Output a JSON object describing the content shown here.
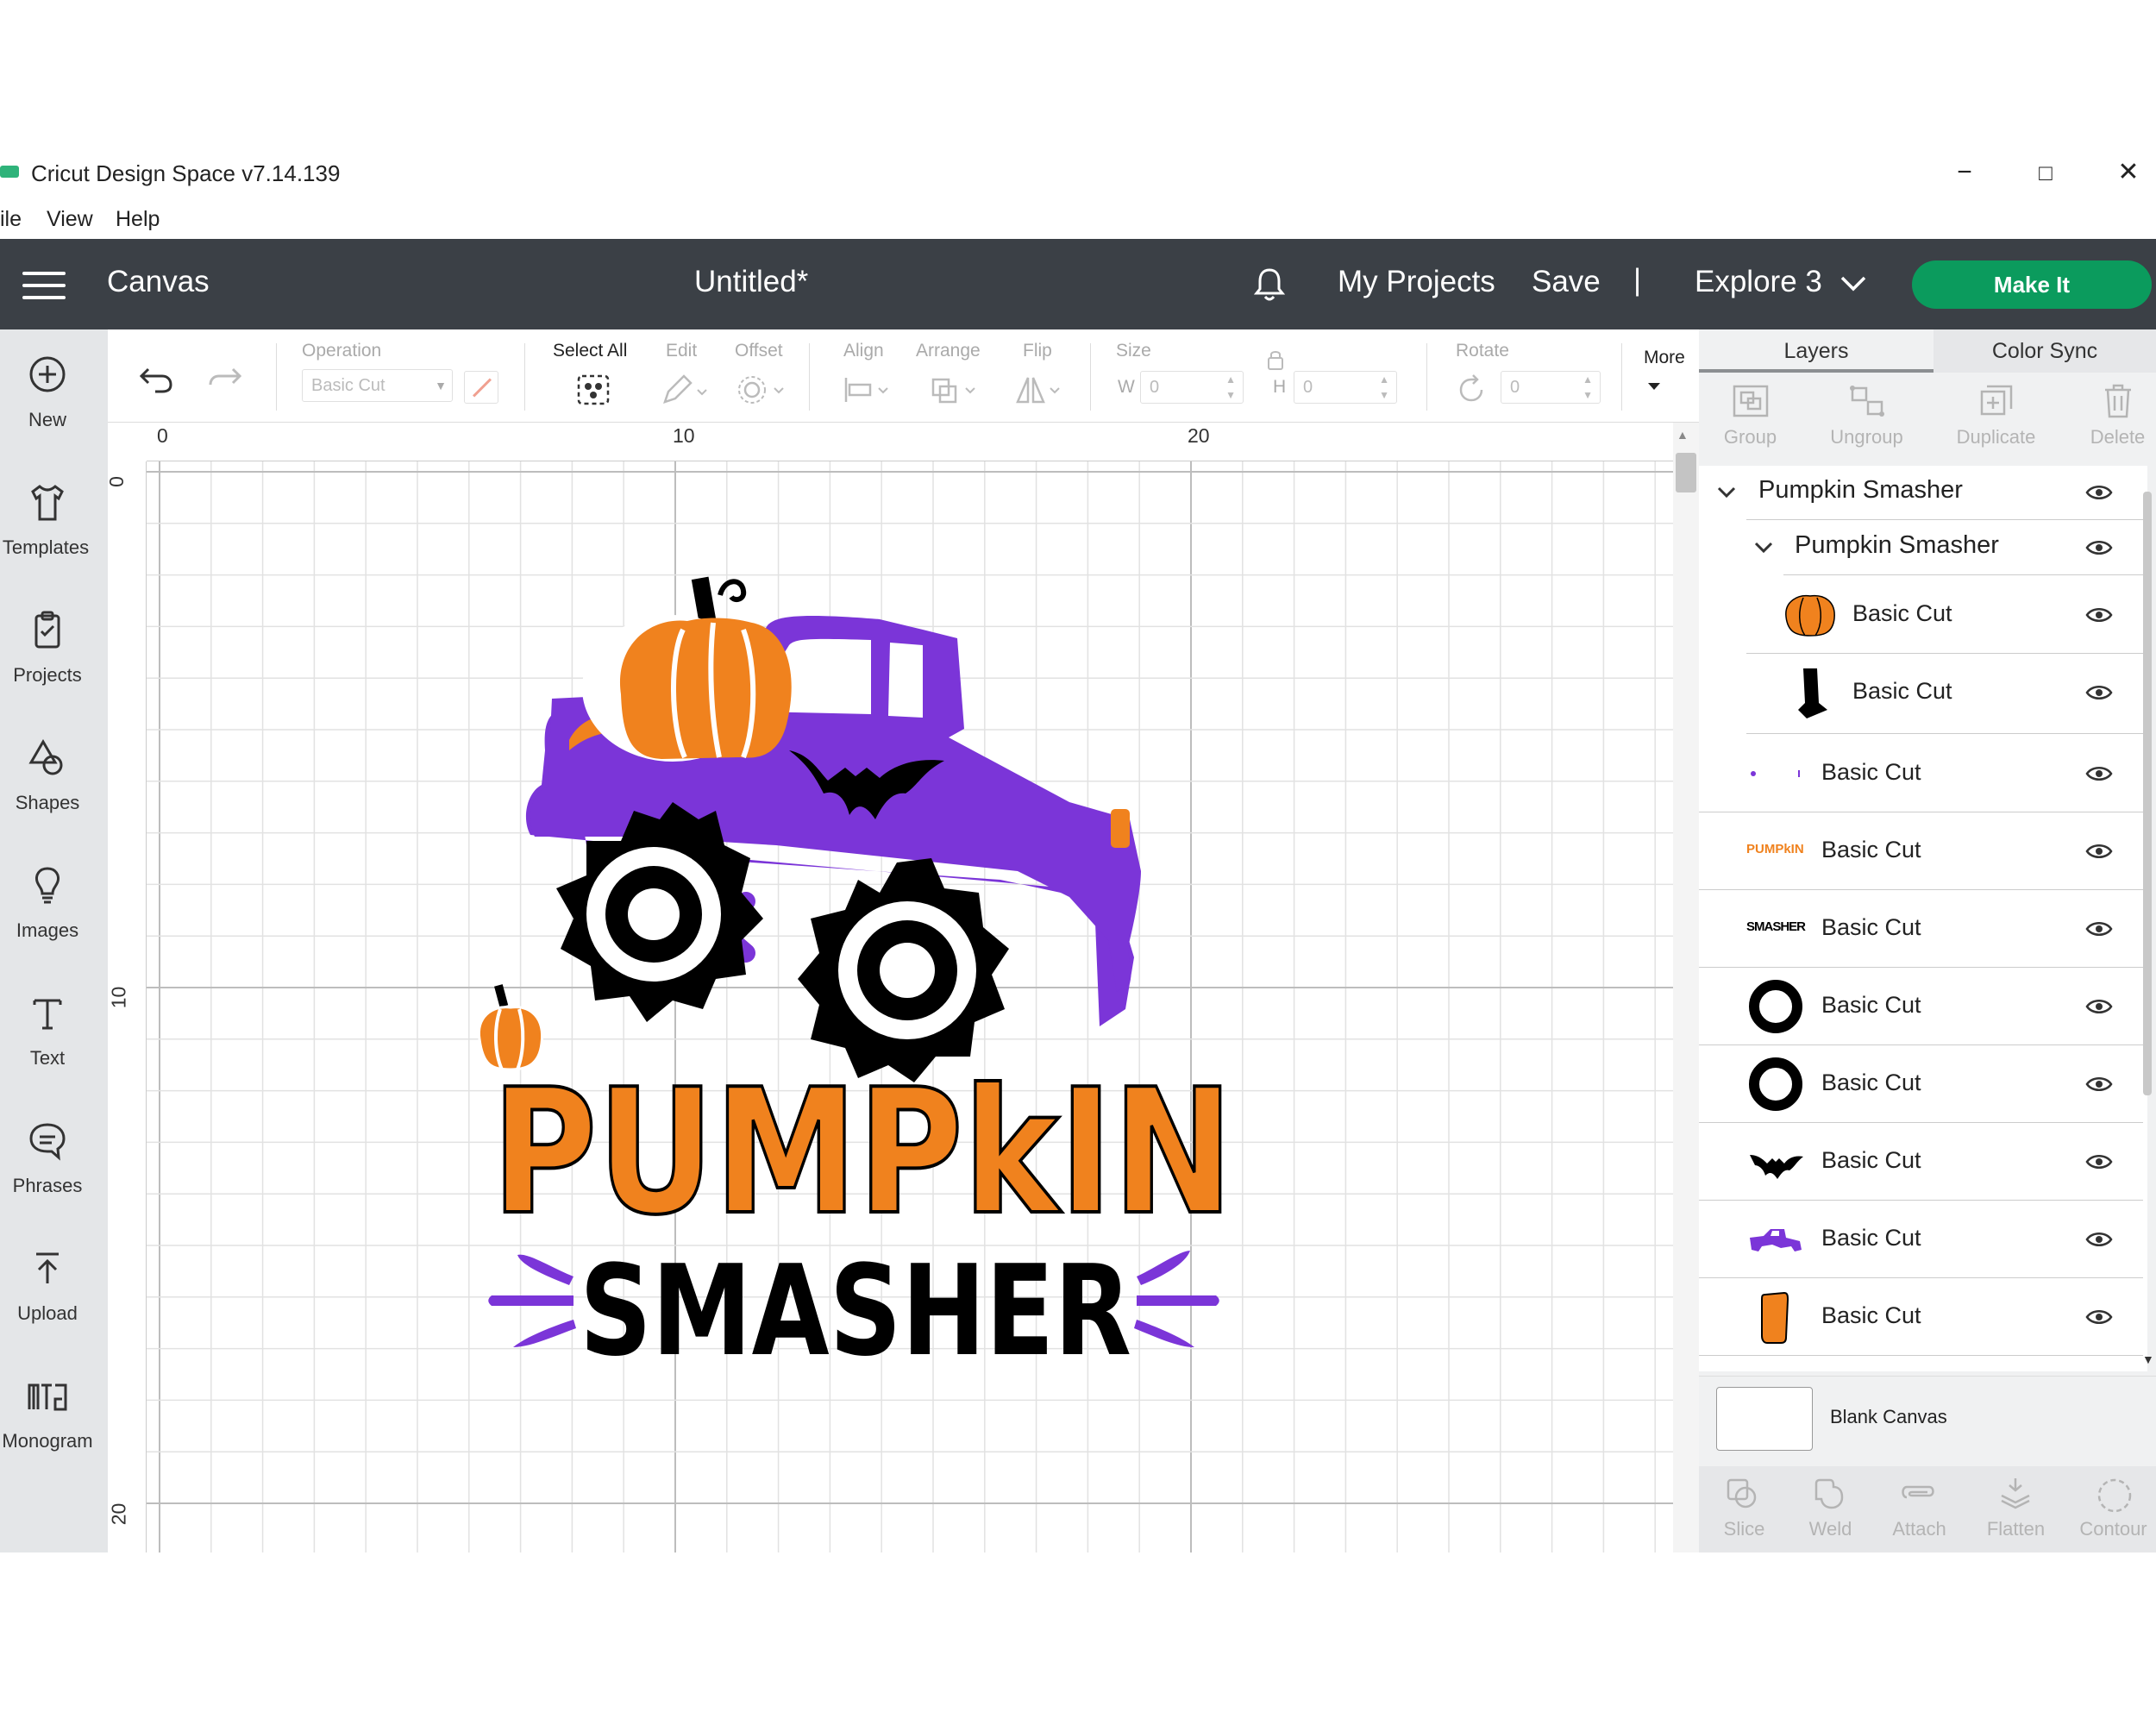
{
  "window": {
    "title": "Cricut Design Space  v7.14.139",
    "minimize": "−",
    "maximize": "□",
    "close": "✕"
  },
  "menu": [
    "ile",
    "View",
    "Help"
  ],
  "header": {
    "canvas_label": "Canvas",
    "doc_title": "Untitled*",
    "my_projects": "My Projects",
    "save": "Save",
    "divider": "|",
    "machine": "Explore 3",
    "make_it": "Make It"
  },
  "sidebar": [
    {
      "label": "New",
      "icon": "plus-circle-icon"
    },
    {
      "label": "Templates",
      "icon": "tshirt-icon"
    },
    {
      "label": "Projects",
      "icon": "clipboard-icon"
    },
    {
      "label": "Shapes",
      "icon": "shapes-icon"
    },
    {
      "label": "Images",
      "icon": "lightbulb-icon"
    },
    {
      "label": "Text",
      "icon": "text-t-icon"
    },
    {
      "label": "Phrases",
      "icon": "speech-bubble-icon"
    },
    {
      "label": "Upload",
      "icon": "upload-icon"
    },
    {
      "label": "Monogram",
      "icon": "monogram-icon"
    }
  ],
  "toolbar": {
    "operation_label": "Operation",
    "operation_value": "Basic Cut",
    "select_all": "Select All",
    "edit": "Edit",
    "offset": "Offset",
    "align": "Align",
    "arrange": "Arrange",
    "flip": "Flip",
    "size": "Size",
    "w": "W",
    "h": "H",
    "w_value": "0",
    "h_value": "0",
    "rotate": "Rotate",
    "rotate_value": "0",
    "more": "More"
  },
  "rulers": {
    "top": [
      "0",
      "10",
      "20"
    ],
    "left": [
      "0",
      "10",
      "20"
    ]
  },
  "design_text": {
    "line1": "PUMPkIN",
    "line2": "SMASHER"
  },
  "colors": {
    "purple": "#7b35d8",
    "orange": "#f0821e",
    "black": "#000000",
    "header_bg": "#3b4046",
    "make_it_green": "#0b9b5d"
  },
  "panel": {
    "tabs": [
      "Layers",
      "Color Sync"
    ],
    "actions": [
      "Group",
      "Ungroup",
      "Duplicate",
      "Delete"
    ],
    "group_top": "Pumpkin Smasher",
    "group_sub": "Pumpkin Smasher",
    "layers": [
      {
        "label": "Basic Cut",
        "thumb": "pumpkin-body"
      },
      {
        "label": "Basic Cut",
        "thumb": "pumpkin-stem"
      },
      {
        "label": "Basic Cut",
        "thumb": "dots"
      },
      {
        "label": "Basic Cut",
        "thumb": "text-pumpkin",
        "thumb_text": "PUMPkIN"
      },
      {
        "label": "Basic Cut",
        "thumb": "text-smasher",
        "thumb_text": "SMASHER"
      },
      {
        "label": "Basic Cut",
        "thumb": "ring"
      },
      {
        "label": "Basic Cut",
        "thumb": "ring"
      },
      {
        "label": "Basic Cut",
        "thumb": "bat"
      },
      {
        "label": "Basic Cut",
        "thumb": "truck"
      },
      {
        "label": "Basic Cut",
        "thumb": "light"
      }
    ],
    "blank_canvas": "Blank Canvas",
    "bottom_tools": [
      "Slice",
      "Weld",
      "Attach",
      "Flatten",
      "Contour"
    ]
  }
}
